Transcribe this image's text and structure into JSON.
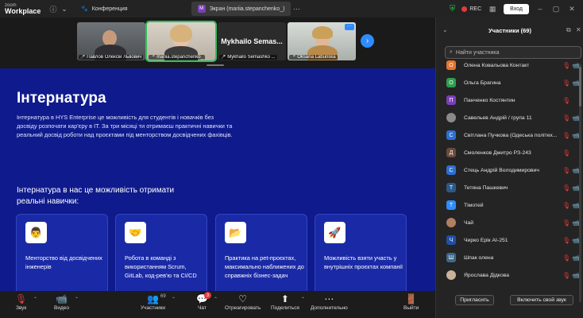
{
  "app": {
    "logo_line1": "zoom",
    "logo_line2": "Workplace"
  },
  "titlebar": {
    "info_icon": "ⓘ",
    "chevron_icon": "⌄",
    "tabs": [
      {
        "icon": "🐾",
        "label": "Конференция"
      },
      {
        "icon": "M",
        "label": "Экран (mariia.stepanchenko_)"
      }
    ],
    "more_icon": "⋯",
    "rec_label": "REC",
    "login_label": "Вход"
  },
  "gallery": {
    "tiles": [
      {
        "caption": "Павлов Олексій Львович"
      },
      {
        "caption": "mariia.stepanchenko_"
      },
      {
        "caption": "Mykhailo Semashko ...",
        "big_name": "Mykhailo  Semas..."
      },
      {
        "caption": "Oksana Labunska"
      }
    ]
  },
  "share": {
    "title": "Інтернатура",
    "intro": "Інтернатура в HYS Enterprise це можливість для студентів і новачків без досвіду розпочати кар'єру в IT. За три місяці ти отримаєш практичні навички та реальний досвід роботи над проєктами під менторством досвідчених фахівців.",
    "subtitle": "Інтернатура в нас це можливість отримати реальні навички:",
    "cards": [
      {
        "icon": "👨",
        "text": "Менторство від досвідчених інженерів"
      },
      {
        "icon": "🤝",
        "text": "Робота в команді з використанням Scrum, GitLab, код-рев'ю та CI/CD"
      },
      {
        "icon": "📂",
        "text": "Практика на pet-проєктах, максимально наближених до справжніх бізнес-задач"
      },
      {
        "icon": "🚀",
        "text": "Можливість взяти участь у внутрішніх проєктах компанії"
      }
    ]
  },
  "toolbar": {
    "audio_label": "Звук",
    "video_label": "Видео",
    "participants_label": "Участники",
    "participants_count": "69",
    "chat_label": "Чат",
    "chat_badge": "3",
    "react_label": "Отреагировать",
    "share_label": "Поделиться",
    "more_label": "Дополнительно",
    "leave_label": "Выйти"
  },
  "panel": {
    "title": "Участники (69)",
    "search_placeholder": "Найти участника",
    "participants": [
      {
        "initial": "О",
        "color": "#e8742d",
        "name": "Олена Ковальова Контакт",
        "cam": true
      },
      {
        "initial": "О",
        "color": "#2e9e4f",
        "name": "Ольга Брагина",
        "cam": true
      },
      {
        "initial": "П",
        "color": "#7b3fb8",
        "name": "Панченко Костянтин",
        "cam": false
      },
      {
        "initial": "",
        "color": "#8a8a8a",
        "name": "Савельев Андрій / група 11",
        "cam": true
      },
      {
        "initial": "С",
        "color": "#2d6fd1",
        "name": "Світлана Пучкова (Одеська політех...",
        "cam": true
      },
      {
        "initial": "Д",
        "color": "#6b4a3a",
        "name": "Смоленков Дмитро РЗ-243",
        "cam": false
      },
      {
        "initial": "С",
        "color": "#2d6fd1",
        "name": "Стець Андрій Володимирович",
        "cam": true
      },
      {
        "initial": "Т",
        "color": "#2a5a8a",
        "name": "Тетяна Пашкевич",
        "cam": true
      },
      {
        "initial": "Т",
        "color": "#2d8cff",
        "name": "Тімотей",
        "cam": true
      },
      {
        "initial": "",
        "color": "#b08060",
        "name": "Чай",
        "cam": true
      },
      {
        "initial": "Ч",
        "color": "#1f4fa8",
        "name": "Чирко Ерік АІ-251",
        "cam": true
      },
      {
        "initial": "Ш",
        "color": "#3d6a8a",
        "name": "Шпак олена",
        "cam": true
      },
      {
        "initial": "",
        "color": "#c9b49a",
        "name": "Ярослава Дідкова",
        "cam": true
      }
    ],
    "invite_label": "Пригласить",
    "unmute_label": "Включить свой звук"
  }
}
